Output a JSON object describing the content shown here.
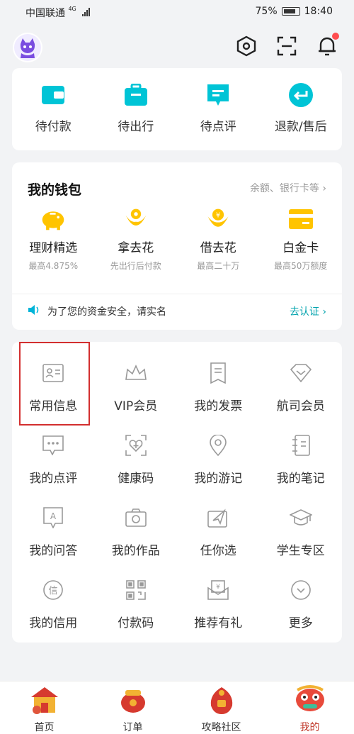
{
  "status_bar": {
    "carrier": "中国联通",
    "network": "4G",
    "battery": "75%",
    "time": "18:40"
  },
  "header": {
    "icons": [
      "settings-hexagon-icon",
      "scan-icon",
      "bell-icon"
    ]
  },
  "orders": [
    {
      "label": "待付款",
      "icon": "wallet-icon"
    },
    {
      "label": "待出行",
      "icon": "suitcase-icon"
    },
    {
      "label": "待点评",
      "icon": "comment-icon"
    },
    {
      "label": "退款/售后",
      "icon": "refund-icon"
    }
  ],
  "wallet": {
    "title": "我的钱包",
    "more": "余额、银行卡等 ›",
    "items": [
      {
        "label": "理财精选",
        "sub": "最高4.875%"
      },
      {
        "label": "拿去花",
        "sub": "先出行后付款"
      },
      {
        "label": "借去花",
        "sub": "最高二十万"
      },
      {
        "label": "白金卡",
        "sub": "最高50万额度"
      }
    ],
    "notice": "为了您的资金安全，请实名",
    "verify": "去认证 ›"
  },
  "tools": [
    {
      "label": "常用信息",
      "icon": "id-card-icon"
    },
    {
      "label": "VIP会员",
      "icon": "crown-icon"
    },
    {
      "label": "我的发票",
      "icon": "invoice-icon"
    },
    {
      "label": "航司会员",
      "icon": "diamond-icon"
    },
    {
      "label": "我的点评",
      "icon": "chat-icon"
    },
    {
      "label": "健康码",
      "icon": "health-heart-icon"
    },
    {
      "label": "我的游记",
      "icon": "location-pin-icon"
    },
    {
      "label": "我的笔记",
      "icon": "notebook-icon"
    },
    {
      "label": "我的问答",
      "icon": "qa-icon"
    },
    {
      "label": "我的作品",
      "icon": "camera-icon"
    },
    {
      "label": "任你选",
      "icon": "plane-card-icon"
    },
    {
      "label": "学生专区",
      "icon": "graduation-cap-icon"
    },
    {
      "label": "我的信用",
      "icon": "credit-icon"
    },
    {
      "label": "付款码",
      "icon": "qr-code-icon"
    },
    {
      "label": "推荐有礼",
      "icon": "gift-envelope-icon"
    },
    {
      "label": "更多",
      "icon": "chevron-down-circle-icon"
    }
  ],
  "tabbar": [
    {
      "label": "首页",
      "active": false
    },
    {
      "label": "订单",
      "active": false
    },
    {
      "label": "攻略社区",
      "active": false
    },
    {
      "label": "我的",
      "active": true
    }
  ],
  "colors": {
    "accent": "#00b4d8",
    "wallet_gold": "#ffc400",
    "highlight": "#d32f2f",
    "link": "#00a3ad"
  }
}
